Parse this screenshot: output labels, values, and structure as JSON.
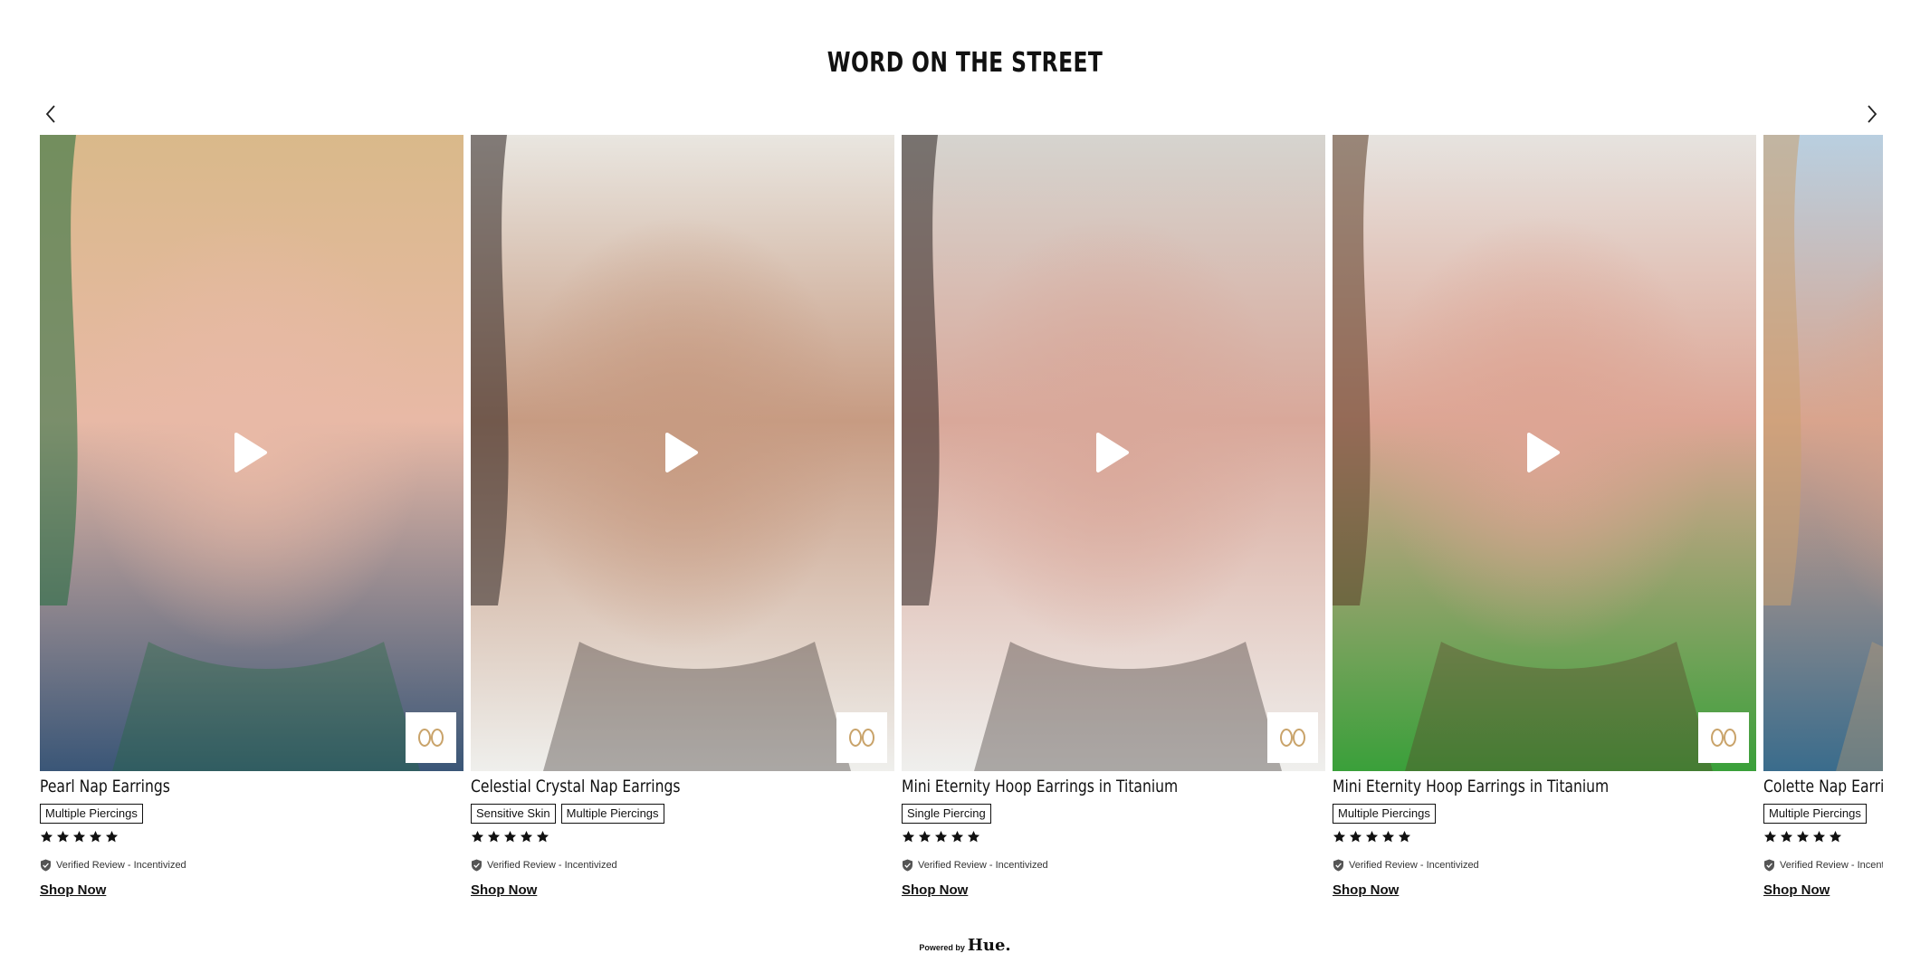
{
  "section_title": "WORD ON THE STREET",
  "carousel": {
    "prev_icon": "chevron-left-icon",
    "next_icon": "chevron-right-icon",
    "cards": [
      {
        "product": "Pearl Nap Earrings",
        "tags": [
          "Multiple Piercings"
        ],
        "rating": 5,
        "verified": "Verified Review - Incentivized",
        "shop": "Shop Now",
        "colors": {
          "top": "#d9b98a",
          "mid": "#e8b9a6",
          "bottom": "#3a5677",
          "accent": "#1f6b3a"
        }
      },
      {
        "product": "Celestial Crystal Nap Earrings",
        "tags": [
          "Sensitive Skin",
          "Multiple Piercings"
        ],
        "rating": 5,
        "verified": "Verified Review - Incentivized",
        "shop": "Shop Now",
        "colors": {
          "top": "#e9e6e0",
          "mid": "#c79b82",
          "bottom": "#efefec",
          "accent": "#2b2320"
        }
      },
      {
        "product": "Mini Eternity Hoop Earrings in Titanium",
        "tags": [
          "Single Piercing"
        ],
        "rating": 5,
        "verified": "Verified Review - Incentivized",
        "shop": "Shop Now",
        "colors": {
          "top": "#d6d4cf",
          "mid": "#d9a89a",
          "bottom": "#efefed",
          "accent": "#2c2320"
        }
      },
      {
        "product": "Mini Eternity Hoop Earrings in Titanium",
        "tags": [
          "Multiple Piercings"
        ],
        "rating": 5,
        "verified": "Verified Review - Incentivized",
        "shop": "Shop Now",
        "colors": {
          "top": "#e6e3df",
          "mid": "#dda594",
          "bottom": "#3aa03a",
          "accent": "#5a3a24"
        }
      },
      {
        "product": "Colette Nap Earrings",
        "tags": [
          "Multiple Piercings"
        ],
        "rating": 5,
        "verified": "Verified Review - Incentivized",
        "shop": "Shop Now",
        "colors": {
          "top": "#b9cfe0",
          "mid": "#d9a48d",
          "bottom": "#3a6c8c",
          "accent": "#c9a070"
        }
      }
    ]
  },
  "footer": {
    "powered_by": "Powered by",
    "brand": "Hue."
  }
}
